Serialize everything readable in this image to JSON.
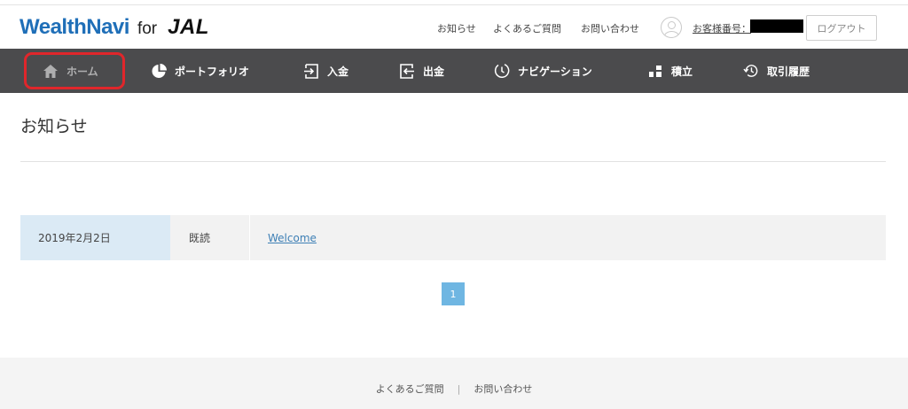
{
  "logo": {
    "brand": "WealthNavi",
    "for": "for",
    "partner": "JAL"
  },
  "header": {
    "links": [
      "お知らせ",
      "よくあるご質問",
      "お問い合わせ"
    ],
    "account_label": "お客様番号：",
    "logout_label": "ログアウト"
  },
  "nav": {
    "items": [
      {
        "label": "ホーム",
        "icon": "home-icon"
      },
      {
        "label": "ポートフォリオ",
        "icon": "pie-chart-icon"
      },
      {
        "label": "入金",
        "icon": "deposit-icon"
      },
      {
        "label": "出金",
        "icon": "withdraw-icon"
      },
      {
        "label": "ナビゲーション",
        "icon": "clock-icon"
      },
      {
        "label": "積立",
        "icon": "blocks-icon"
      },
      {
        "label": "取引履歴",
        "icon": "history-icon"
      }
    ],
    "highlight_color": "#e0262b"
  },
  "page": {
    "title": "お知らせ"
  },
  "notices": [
    {
      "date": "2019年2月2日",
      "status": "既読",
      "title": "Welcome"
    }
  ],
  "pagination": {
    "current": "1"
  },
  "footer": {
    "links": [
      "よくあるご質問",
      "お問い合わせ"
    ],
    "separator": "|"
  },
  "colors": {
    "nav_bg": "#4b4b4d",
    "brand_blue": "#1f6fb8",
    "date_cell_bg": "#dbeaf5",
    "pager_bg": "#6fb6e2"
  }
}
